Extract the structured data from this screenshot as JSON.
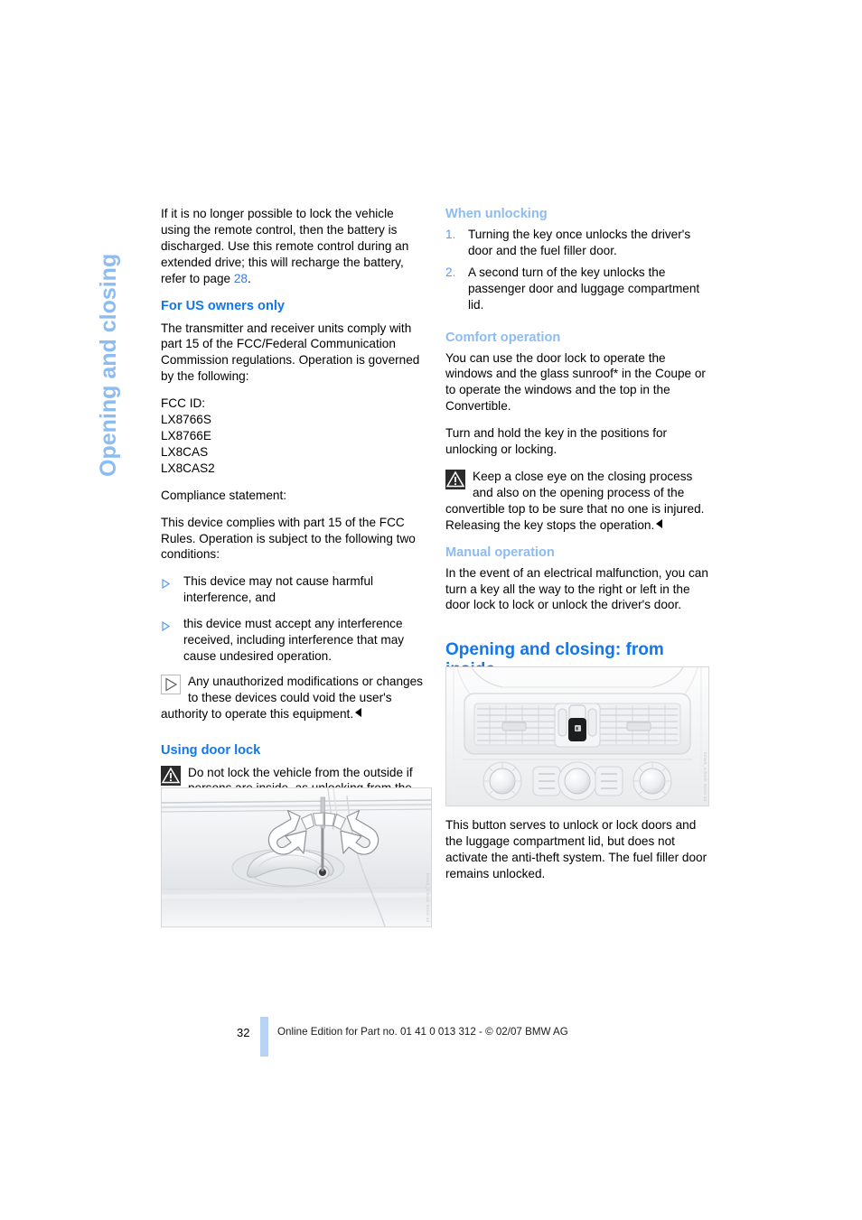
{
  "side_tab": {
    "label": "Opening and closing"
  },
  "colors": {
    "heading_blue": "#1277ef",
    "subheading_blue": "#8cbcf2",
    "link_blue": "#3f76e0",
    "footer_bar": "#b9d4f2"
  },
  "left_column": {
    "intro_paragraph": "If it is no longer possible to lock the vehicle using the remote control, then the battery is discharged. Use this remote control during an extended drive; this will recharge the battery, refer to page ",
    "intro_page_link": "28",
    "intro_paragraph_end": ".",
    "us_owners": {
      "heading": "For US owners only",
      "paragraph": "The transmitter and receiver units comply with part 15 of the FCC/Federal Communication Commission regulations. Operation is governed by the following:",
      "fcc_lines": [
        "FCC ID:",
        "LX8766S",
        "LX8766E",
        "LX8CAS",
        "LX8CAS2"
      ],
      "compliance_lines": [
        "Compliance statement:",
        "This device complies with part 15 of the FCC Rules. Operation is subject to the following two conditions:"
      ],
      "conditions": [
        "This device may not cause harmful interference, and",
        "this device must accept any interference received, including interference that may cause undesired operation."
      ],
      "note": "Any unauthorized modifications or changes to these devices could void the user's authority to operate this equipment."
    },
    "using_door_lock": {
      "heading": "Using door lock",
      "warning": "Do not lock the vehicle from the outside if persons are inside, as unlocking from the inside is not possible without special knowledge."
    },
    "figure_door": {
      "name": "door-handle-key-illustration",
      "credit": "bmw5_o.book  Seite 32"
    }
  },
  "right_column": {
    "when_unlocking": {
      "heading": "When unlocking",
      "items": [
        "Turning the key once unlocks the driver's door and the fuel filler door.",
        "A second turn of the key unlocks the passenger door and luggage compartment lid."
      ],
      "markers": [
        "1.",
        "2."
      ]
    },
    "comfort_operation": {
      "heading": "Comfort operation",
      "paragraph_1_before_star": "You can use the door lock to operate the windows and the glass sunroof",
      "star": "*",
      "paragraph_1_after_star": " in the Coupe or to operate the windows and the top in the Convertible.",
      "paragraph_2": "Turn and hold the key in the positions for unlocking or locking.",
      "warning": "Keep a close eye on the closing process and also on the opening process of the convertible top to be sure that no one is injured. Releasing the key stops the operation."
    },
    "manual_operation": {
      "heading": "Manual operation",
      "paragraph": "In the event of an electrical malfunction, you can turn a key all the way to the right or left in the door lock to lock or unlock the driver's door."
    },
    "section_heading": "Opening and closing: from inside",
    "figure_console": {
      "name": "center-console-lock-button-illustration",
      "credit": "bmw5_o.book  Seite 32"
    },
    "figure_caption": "This button serves to unlock or lock doors and the luggage compartment lid, but does not activate the anti-theft system. The fuel filler door remains unlocked."
  },
  "footer": {
    "page_number": "32",
    "text": "Online Edition for Part no. 01 41 0 013 312 - © 02/07 BMW AG"
  }
}
